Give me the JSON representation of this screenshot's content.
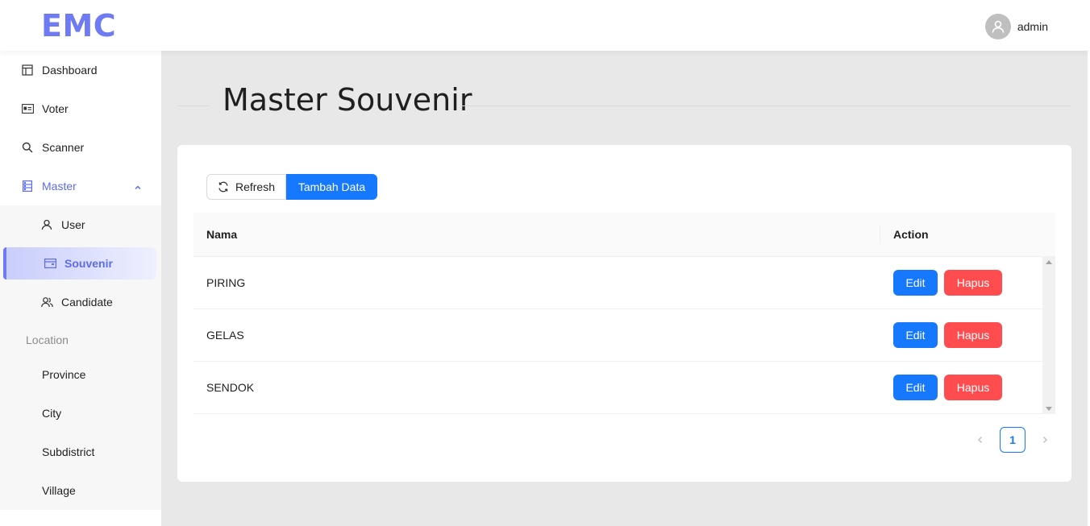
{
  "app": {
    "logo": "EMC"
  },
  "header": {
    "user_name": "admin"
  },
  "sidebar": {
    "items": [
      {
        "label": "Dashboard",
        "icon": "dashboard-icon"
      },
      {
        "label": "Voter",
        "icon": "id-card-icon"
      },
      {
        "label": "Scanner",
        "icon": "search-icon"
      },
      {
        "label": "Master",
        "icon": "database-icon",
        "expanded": true
      }
    ],
    "master_sub": [
      {
        "label": "User",
        "icon": "user-icon"
      },
      {
        "label": "Souvenir",
        "icon": "wallet-icon",
        "active": true
      },
      {
        "label": "Candidate",
        "icon": "team-icon"
      }
    ],
    "location_group": "Location",
    "location_items": [
      {
        "label": "Province"
      },
      {
        "label": "City"
      },
      {
        "label": "Subdistrict"
      },
      {
        "label": "Village"
      }
    ]
  },
  "page": {
    "title": "Master Souvenir"
  },
  "toolbar": {
    "refresh_label": "Refresh",
    "add_label": "Tambah Data"
  },
  "table": {
    "columns": [
      "Nama",
      "Action"
    ],
    "rows": [
      {
        "nama": "PIRING"
      },
      {
        "nama": "GELAS"
      },
      {
        "nama": "SENDOK"
      }
    ],
    "edit_label": "Edit",
    "delete_label": "Hapus"
  },
  "pagination": {
    "current_page": "1"
  },
  "colors": {
    "accent": "#6e7bf2",
    "primary": "#1677ff",
    "danger": "#ff4d4f"
  }
}
